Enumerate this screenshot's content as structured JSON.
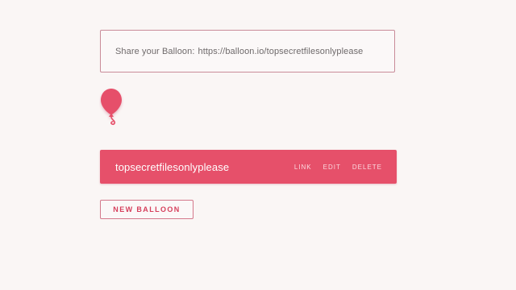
{
  "share": {
    "label": "Share your Balloon:",
    "url": "https://balloon.io/topsecretfilesonlyplease"
  },
  "logo": {
    "icon": "balloon-icon",
    "color": "#e6506a"
  },
  "balloons": [
    {
      "name": "topsecretfilesonlyplease",
      "actions": {
        "link": "LINK",
        "edit": "EDIT",
        "delete": "DELETE"
      }
    }
  ],
  "new_balloon_label": "NEW BALLOON",
  "colors": {
    "accent": "#e6506a",
    "background": "#faf6f5",
    "border": "#c98b99"
  }
}
